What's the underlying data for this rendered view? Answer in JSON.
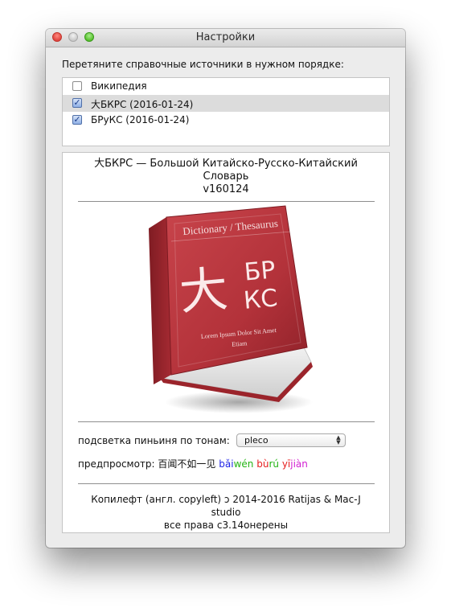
{
  "window": {
    "title": "Настройки"
  },
  "instruction": "Перетяните справочные источники в нужном порядке:",
  "sources": [
    {
      "label": "Википедия",
      "checked": false,
      "highlighted": false
    },
    {
      "label": "大БКРС (2016-01-24)",
      "checked": true,
      "highlighted": true
    },
    {
      "label": "БРуКС (2016-01-24)",
      "checked": true,
      "highlighted": false
    }
  ],
  "dictionary": {
    "title_line1": "大БКРС — Большой Китайско-Русско-Китайский",
    "title_line2": "Словарь",
    "version": "v160124",
    "cover": {
      "header": "Dictionary / Thesaurus",
      "hanzi": "大",
      "cyrillic_top": "БР",
      "cyrillic_bottom": "КС",
      "subtitle_line1": "Lorem Ipsum Dolor Sit Amet",
      "subtitle_line2": "Etiam",
      "color": "#b3323a"
    }
  },
  "tone_highlight": {
    "label": "подсветка пиньиня по тонам:",
    "selected": "pleco"
  },
  "preview": {
    "label": "предпросмотр:",
    "hanzi": "百闻不如一见",
    "syllables": [
      {
        "text": "bǎi",
        "color": "#1f24e6"
      },
      {
        "text": "wén",
        "color": "#23b414"
      },
      {
        "text": " "
      },
      {
        "text": "bù",
        "color": "#e61e1e"
      },
      {
        "text": "rú",
        "color": "#23b414"
      },
      {
        "text": " "
      },
      {
        "text": "yī",
        "color": "#e61e1e"
      },
      {
        "text": "jiàn",
        "color": "#d21ed2"
      }
    ]
  },
  "credits": {
    "line1": "Копилефт (англ. copyleft) ↄ 2014-2016 Ratijas & Mac-J",
    "line2": "studio",
    "line3": "все права с3.14онерены"
  }
}
